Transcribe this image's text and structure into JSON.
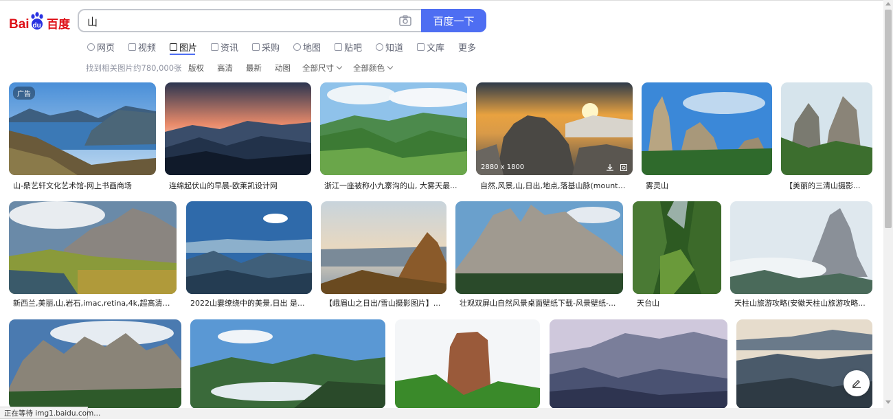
{
  "logo": {
    "text_latin": "Bai",
    "text_cn": "百度",
    "paw": "du"
  },
  "search": {
    "query": "山",
    "button_label": "百度一下"
  },
  "nav": {
    "items": [
      {
        "label": "网页",
        "icon": "search-icon"
      },
      {
        "label": "视频",
        "icon": "video-icon"
      },
      {
        "label": "图片",
        "icon": "image-icon",
        "active": true
      },
      {
        "label": "资讯",
        "icon": "news-icon"
      },
      {
        "label": "采购",
        "icon": "purchase-icon"
      },
      {
        "label": "地图",
        "icon": "map-icon"
      },
      {
        "label": "贴吧",
        "icon": "tieba-icon"
      },
      {
        "label": "知道",
        "icon": "question-icon"
      },
      {
        "label": "文库",
        "icon": "doc-icon"
      },
      {
        "label": "更多"
      }
    ]
  },
  "filters": {
    "count": "找到相关图片约780,000张",
    "copyright": "版权",
    "hd": "高清",
    "latest": "最新",
    "animated": "动图",
    "size": "全部尺寸",
    "color": "全部颜色"
  },
  "results": {
    "row1": [
      {
        "caption": "山-鼎艺轩文化艺术馆-网上书画商场",
        "ad_badge": "广告"
      },
      {
        "caption": "连绵起伏山的早晨-欧莱凯设计网"
      },
      {
        "caption": "浙江一座被称小九寨沟的山, 大雾天最..."
      },
      {
        "caption": "自然,风景,山,日出,地点,落基山脉(mountai...",
        "size": "2880 x 1800"
      },
      {
        "caption": "雾灵山"
      },
      {
        "caption": "【美丽的三清山摄影..."
      }
    ],
    "row2": [
      {
        "caption": "新西兰,美丽,山,岩石,imac,retina,4k,超高清图..."
      },
      {
        "caption": "2022山霎缭绕中的美景,日出 是..."
      },
      {
        "caption": "【峨眉山之日出/雪山摄影图片】..."
      },
      {
        "caption": "壮观双屏山自然风景桌面壁纸下载-风景壁纸-..."
      },
      {
        "caption": "天台山"
      },
      {
        "caption": "天柱山旅游攻略(安徽天柱山旅游攻略..."
      }
    ]
  },
  "status_bar": {
    "text": "正在等待 img1.baidu.com..."
  },
  "colors": {
    "accent": "#4e6ef2",
    "baidu_red": "#de0f17",
    "baidu_blue": "#2932e1"
  }
}
